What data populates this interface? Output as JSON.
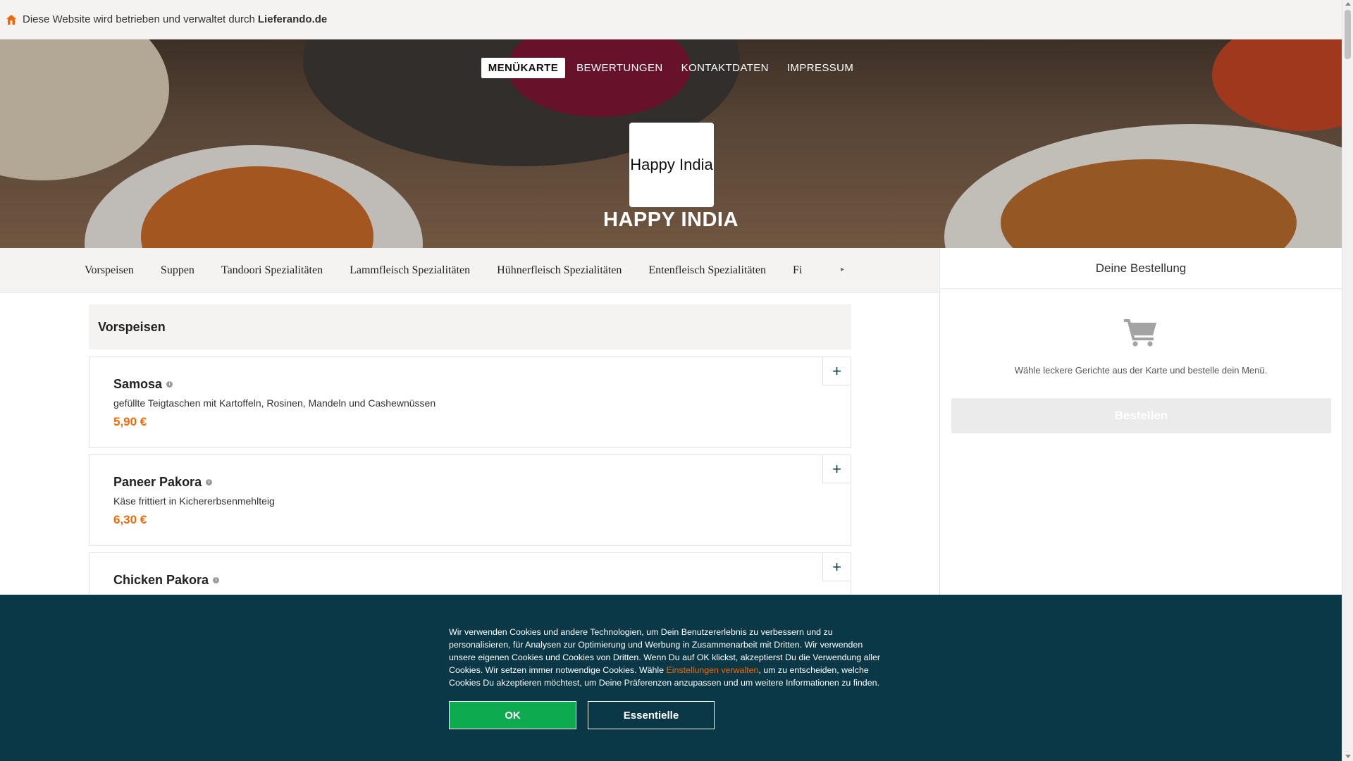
{
  "topbar": {
    "icon": "home-icon",
    "text": "Diese Website wird betrieben und verwaltet durch",
    "brand": "Lieferando.de"
  },
  "nav": {
    "items": [
      "MENÜKARTE",
      "BEWERTUNGEN",
      "KONTAKTDATEN",
      "IMPRESSUM"
    ],
    "active": "MENÜKARTE"
  },
  "restaurant": {
    "logo_text": "Happy India",
    "name": "HAPPY INDIA"
  },
  "categories": {
    "items": [
      "Vorspeisen",
      "Suppen",
      "Tandoori Spezialitäten",
      "Lammfleisch Spezialitäten",
      "Hühnerfleisch Spezialitäten",
      "Entenfleisch Spezialitäten",
      "Fi"
    ],
    "more_icon": "chevron-right-icon"
  },
  "menu": {
    "section_title": "Vorspeisen",
    "items": [
      {
        "name": "Samosa",
        "description": "gefüllte Teigtaschen mit Kartoffeln, Rosinen, Mandeln und Cashewnüssen",
        "price": "5,90 €"
      },
      {
        "name": "Paneer Pakora",
        "description": "Käse frittiert in Kichererbsenmehlteig",
        "price": "6,30 €"
      },
      {
        "name": "Chicken Pakora",
        "description": "",
        "price": ""
      }
    ],
    "add_label": "+"
  },
  "basket": {
    "title": "Deine Bestellung",
    "icon": "cart-icon",
    "empty_text": "Wähle leckere Gerichte aus der Karte und bestelle dein Menü.",
    "order_button": "Bestellen"
  },
  "cookie": {
    "text_before": "Wir verwenden Cookies und andere Technologien, um Dein Benutzererlebnis zu verbessern und zu personalisieren, für Analysen zur Optimierung und Werbung in Zusammenarbeit mit Dritten. Wir verwenden unsere eigenen Cookies und Cookies von Dritten. Wenn Du auf OK klickst, akzeptierst Du die Verwendung aller Cookies. Wir setzen immer notwendige Cookies. Wähle ",
    "link": "Einstellungen verwalten",
    "text_after": ", um zu entscheiden, welche Cookies Du akzeptieren möchtest, um Deine Präferenzen anzupassen und um weitere Informationen zu finden.",
    "ok_button": "OK",
    "essential_button": "Essentielle"
  },
  "colors": {
    "accent": "#f36805",
    "cookie_bg": "#0a3847",
    "ok_green": "#0eaa4f",
    "panel_bg": "#f5f3f1"
  }
}
